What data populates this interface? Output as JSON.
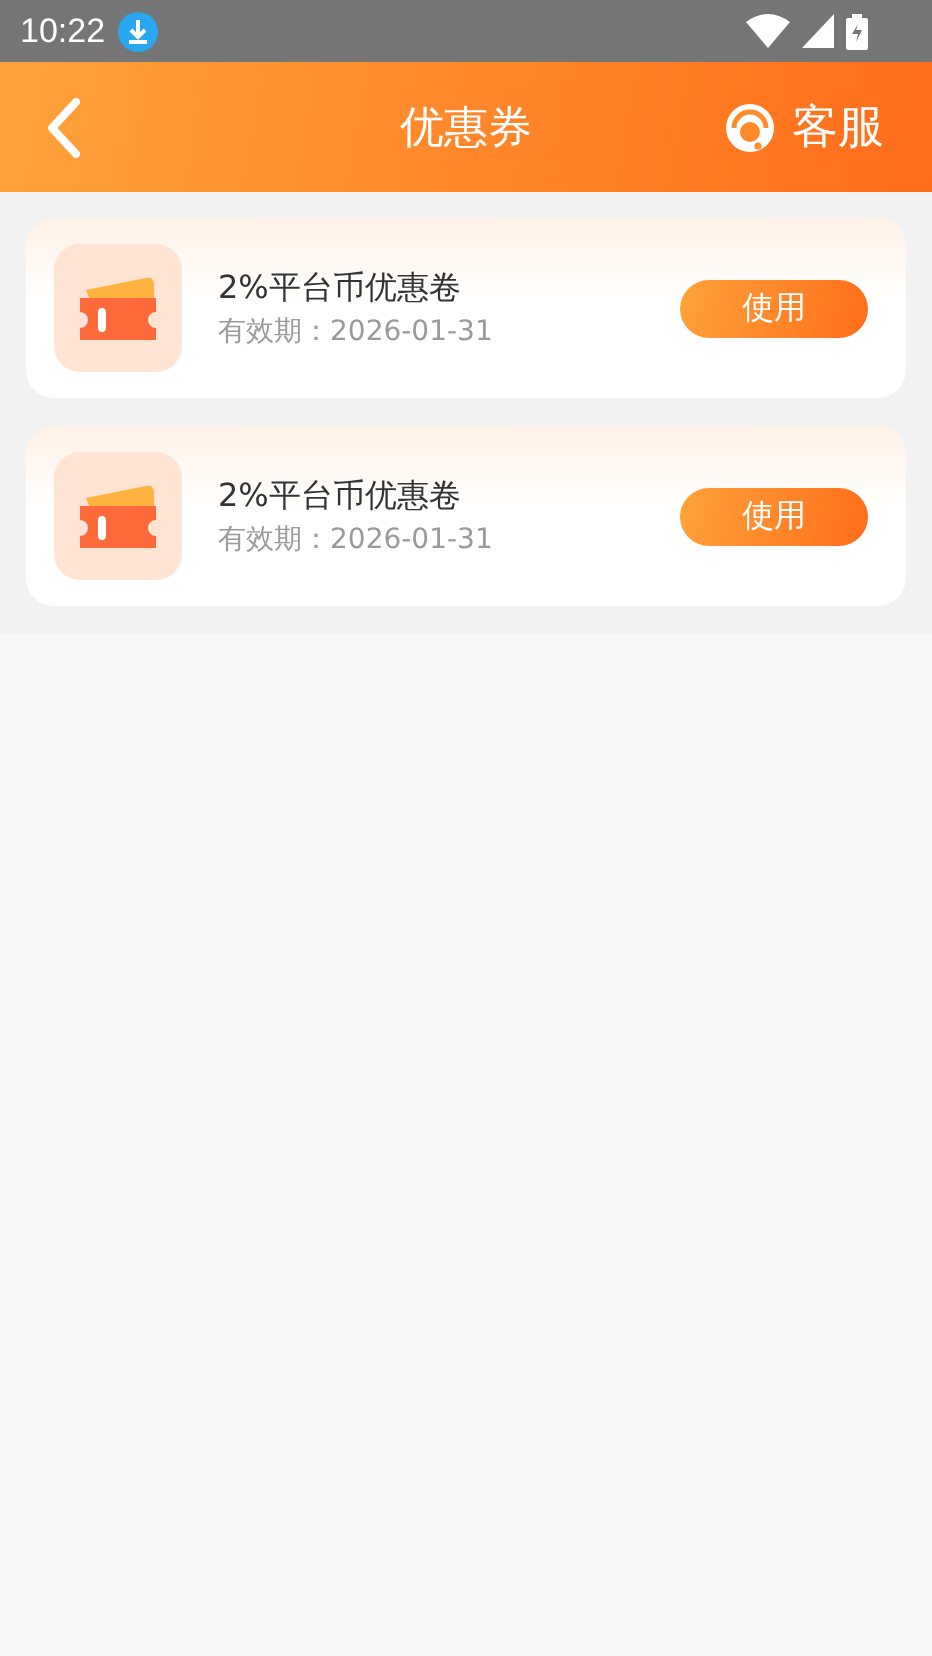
{
  "status_bar": {
    "time": "10:22"
  },
  "header": {
    "title": "优惠券",
    "service_label": "客服"
  },
  "coupons": [
    {
      "title": "2%平台币优惠卷",
      "validity": "有效期：2026-01-31",
      "button": "使用"
    },
    {
      "title": "2%平台币优惠卷",
      "validity": "有效期：2026-01-31",
      "button": "使用"
    }
  ]
}
